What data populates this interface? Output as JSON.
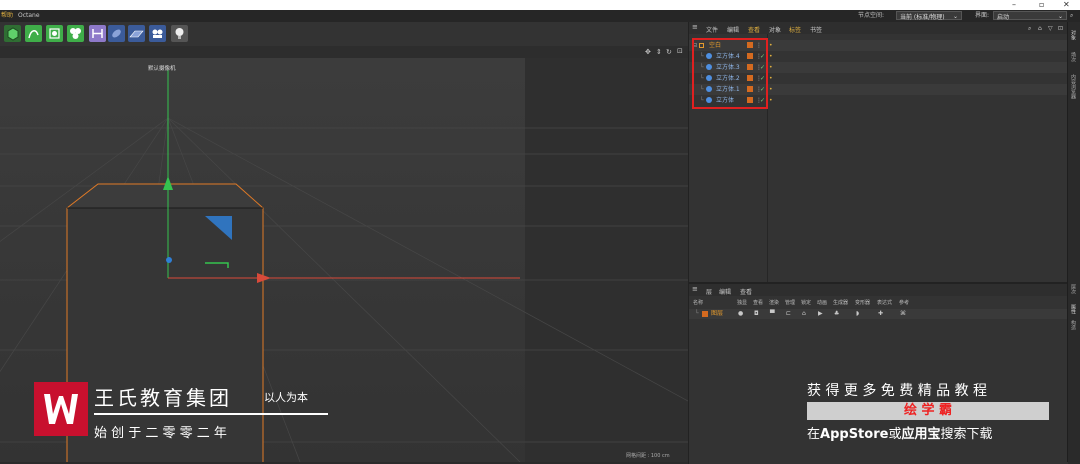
{
  "window": {
    "controls": [
      "–",
      "▫",
      "✕"
    ]
  },
  "menubar": {
    "items": [
      "帮助",
      "Octane"
    ],
    "node_space_label": "节点空间:",
    "node_space_value": "当前 (标准/物理)",
    "interface_label": "界面:",
    "interface_value": "启动"
  },
  "toolbar": {
    "icons": [
      {
        "name": "cube-primitive-icon",
        "color": "#3fae49"
      },
      {
        "name": "spline-pen-icon",
        "color": "#3fae49"
      },
      {
        "name": "subdivision-icon",
        "color": "#3fae49"
      },
      {
        "name": "cloner-icon",
        "color": "#3fae49"
      },
      {
        "name": "deformer-icon",
        "color": "#8e79c9"
      },
      {
        "name": "field-icon",
        "color": "#8aa2d8"
      },
      {
        "name": "floor-icon",
        "color": "#8aa2d8"
      },
      {
        "name": "camera-icon",
        "color": "#8aa2d8"
      },
      {
        "name": "light-icon",
        "color": "#e6e6e6"
      }
    ]
  },
  "viewport": {
    "camera_label": "默认摄像机 ",
    "grid_spacing": "网格间距 : 100 cm",
    "axis_colors": {
      "x": "#d94a3a",
      "y": "#35c34f",
      "z": "#2f7fd6"
    },
    "selection_color": "#e07a26"
  },
  "object_manager": {
    "tabs": [
      "文件",
      "编辑",
      "查看",
      "对象",
      "标签",
      "书签"
    ],
    "objects": [
      {
        "name": "空白",
        "level": 0,
        "type": "null"
      },
      {
        "name": "立方体.4",
        "level": 1,
        "type": "cube"
      },
      {
        "name": "立方体.3",
        "level": 1,
        "type": "cube"
      },
      {
        "name": "立方体.2",
        "level": 1,
        "type": "cube"
      },
      {
        "name": "立方体.1",
        "level": 1,
        "type": "cube"
      },
      {
        "name": "立方体",
        "level": 1,
        "type": "cube"
      }
    ],
    "highlight_color": "#e02020"
  },
  "layer_manager": {
    "tabs": [
      "层",
      "编辑",
      "查看"
    ],
    "columns": [
      "名称",
      "独显",
      "查看",
      "渲染",
      "管理",
      "锁定",
      "动画",
      "生成器",
      "变形器",
      "表达式",
      "参考"
    ],
    "layer_name": "图层"
  },
  "right_strip": {
    "tabs": [
      "对象",
      "场次",
      "内容浏览器",
      "层次",
      "属性",
      "构造"
    ]
  },
  "brand": {
    "name": "王氏教育集团",
    "slogan": "以人为本",
    "founded": "始 创 于 二 零 零 二 年",
    "logo_color": "#c8102e"
  },
  "promo": {
    "line1": "获 得 更 多 免 费 精 品 教 程",
    "line2": "绘 学 霸",
    "line3_prefix": "在",
    "line3_store": "AppStore",
    "line3_mid": "或",
    "line3_app": "应用宝",
    "line3_suffix": "搜索下载",
    "highlight_color": "#ee2222"
  }
}
